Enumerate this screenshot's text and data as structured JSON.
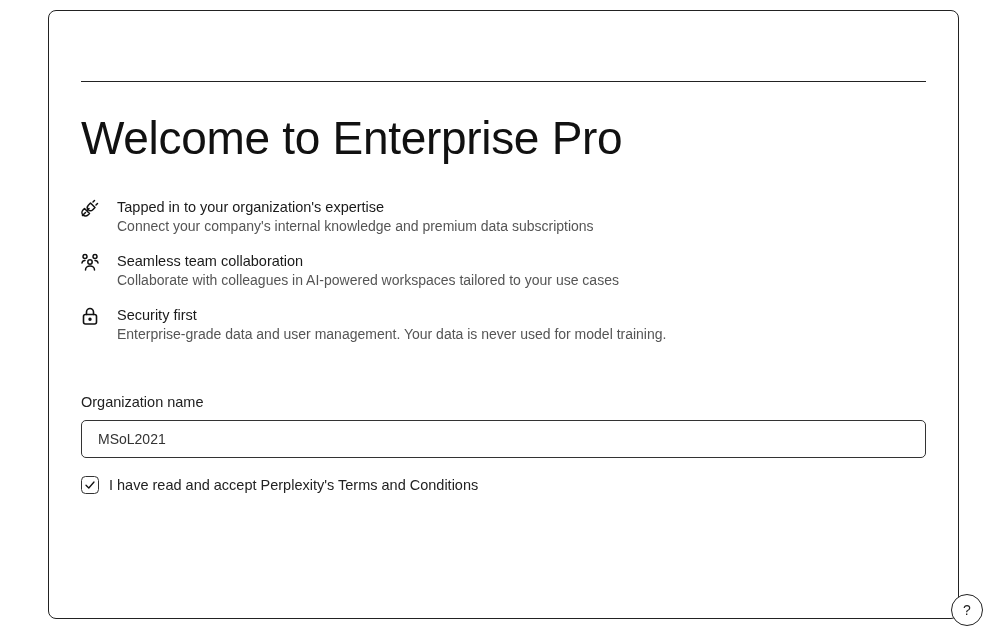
{
  "title": "Welcome to Enterprise Pro",
  "features": [
    {
      "kind": "plug",
      "title": "Tapped in to your organization's expertise",
      "description": "Connect your company's internal knowledge and premium data subscriptions"
    },
    {
      "kind": "team",
      "title": "Seamless team collaboration",
      "description": "Collaborate with colleagues in AI-powered workspaces tailored to your use cases"
    },
    {
      "kind": "lock",
      "title": "Security first",
      "description": "Enterprise-grade data and user management. Your data is never used for model training."
    }
  ],
  "organization_field": {
    "label": "Organization name",
    "value": "MSoL2021"
  },
  "terms": {
    "label": "I have read and accept Perplexity's Terms and Conditions",
    "checked": true
  },
  "help_button": {
    "label": "?"
  }
}
